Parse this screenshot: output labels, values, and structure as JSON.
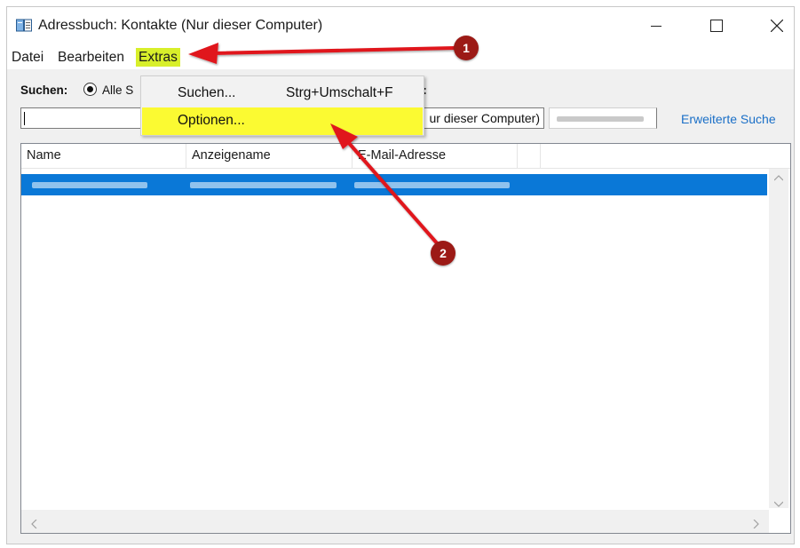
{
  "window": {
    "title": "Adressbuch: Kontakte (Nur dieser Computer)",
    "icon": "address-book-icon",
    "controls": [
      "minimize-icon",
      "maximize-icon",
      "close-icon"
    ]
  },
  "menubar": {
    "items": [
      {
        "label": "Datei"
      },
      {
        "label": "Bearbeiten"
      },
      {
        "label": "Extras",
        "active": true
      }
    ]
  },
  "dropdown": {
    "items": [
      {
        "label": "Suchen...",
        "shortcut": "Strg+Umschalt+F"
      },
      {
        "label": "Optionen...",
        "highlighted": true
      }
    ]
  },
  "search": {
    "label": "Suchen:",
    "radio_label": "Alle S",
    "in_label": "n:",
    "input_value": "",
    "addressbook_value": "ur dieser Computer)",
    "advanced_link": "Erweiterte Suche"
  },
  "list": {
    "columns": [
      "Name",
      "Anzeigename",
      "E-Mail-Adresse"
    ],
    "rows": [
      {
        "name": "",
        "display_name": "",
        "email": "",
        "selected": true,
        "redacted": true
      }
    ]
  },
  "annotations": [
    {
      "number": "1",
      "target": "Extras"
    },
    {
      "number": "2",
      "target": "Optionen..."
    }
  ],
  "colors": {
    "highlight_yellow": "#fbfa32",
    "menu_highlight": "#d8ef2a",
    "selection_blue": "#0a78d7",
    "arrow_red": "#e0141c",
    "badge_red": "#9c1a16",
    "link_blue": "#1a6fc7"
  }
}
